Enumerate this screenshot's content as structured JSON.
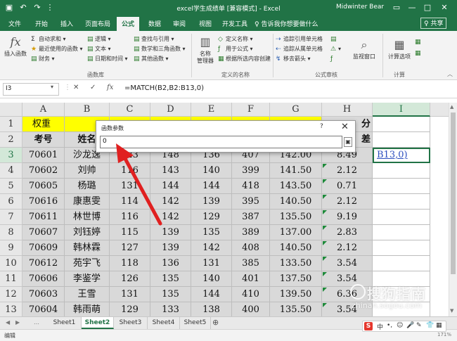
{
  "titlebar": {
    "title": "excel学生成绩单 [兼容模式] - Excel",
    "user": "Midwinter Bear",
    "icons": [
      "save-icon",
      "undo-icon",
      "redo-icon",
      "customize-icon"
    ]
  },
  "tabs": {
    "items": [
      "文件",
      "开始",
      "插入",
      "页面布局",
      "公式",
      "数据",
      "审阅",
      "视图",
      "开发工具"
    ],
    "active": "公式",
    "tell_me": "♀ 告诉我你想要做什么",
    "share": "♀ 共享"
  },
  "ribbon": {
    "insert_function": "插入函数",
    "autosum": "自动求和",
    "recent": "最近使用的函数",
    "financial": "财务",
    "logical": "逻辑",
    "text": "文本",
    "datetime": "日期和时间",
    "lookup": "查找与引用",
    "math": "数学和三角函数",
    "other": "其他函数",
    "group_library": "函数库",
    "name_manager": "名称\n管理器",
    "define_name": "定义名称",
    "use_in_formula": "用于公式",
    "create_from_sel": "根据所选内容创建",
    "group_names": "定义的名称",
    "trace_prec": "追踪引用单元格",
    "trace_dep": "追踪从属单元格",
    "remove_arrows": "移去箭头",
    "group_audit": "公式审核",
    "watch": "监视窗口",
    "calc_options": "计算选项",
    "group_calc": "计算"
  },
  "formula_bar": {
    "name_box": "I3",
    "formula": "=MATCH(B2,B2:B13,0)"
  },
  "grid": {
    "columns": [
      "A",
      "B",
      "C",
      "D",
      "E",
      "F",
      "G",
      "H",
      "I"
    ],
    "row_numbers": [
      "1",
      "2",
      "3",
      "4",
      "5",
      "6",
      "7",
      "8",
      "9",
      "10",
      "11",
      "12",
      "13"
    ],
    "row1": {
      "a": "权重",
      "h": "分"
    },
    "row2": {
      "a": "考号",
      "b": "姓名",
      "h": "差"
    },
    "rows": [
      {
        "a": "70601",
        "b": "沙龙逸",
        "c": "123",
        "d": "148",
        "e": "136",
        "f": "407",
        "g": "142.00",
        "h": "8.49"
      },
      {
        "a": "70602",
        "b": "刘帅",
        "c": "116",
        "d": "143",
        "e": "140",
        "f": "399",
        "g": "141.50",
        "h": "2.12"
      },
      {
        "a": "70605",
        "b": "杨璐",
        "c": "131",
        "d": "144",
        "e": "144",
        "f": "418",
        "g": "143.50",
        "h": "0.71"
      },
      {
        "a": "70616",
        "b": "康惠雯",
        "c": "114",
        "d": "142",
        "e": "139",
        "f": "395",
        "g": "140.50",
        "h": "2.12"
      },
      {
        "a": "70611",
        "b": "林世博",
        "c": "116",
        "d": "142",
        "e": "129",
        "f": "387",
        "g": "135.50",
        "h": "9.19"
      },
      {
        "a": "70607",
        "b": "刘钰婷",
        "c": "115",
        "d": "139",
        "e": "135",
        "f": "389",
        "g": "137.00",
        "h": "2.83"
      },
      {
        "a": "70609",
        "b": "韩林霖",
        "c": "127",
        "d": "139",
        "e": "142",
        "f": "408",
        "g": "140.50",
        "h": "2.12"
      },
      {
        "a": "70612",
        "b": "苑宇飞",
        "c": "118",
        "d": "136",
        "e": "131",
        "f": "385",
        "g": "133.50",
        "h": "3.54"
      },
      {
        "a": "70606",
        "b": "李鉴学",
        "c": "126",
        "d": "135",
        "e": "140",
        "f": "401",
        "g": "137.50",
        "h": "3.54"
      },
      {
        "a": "70603",
        "b": "王雪",
        "c": "131",
        "d": "135",
        "e": "144",
        "f": "410",
        "g": "139.50",
        "h": "6.36"
      },
      {
        "a": "70604",
        "b": "韩雨萌",
        "c": "129",
        "d": "133",
        "e": "138",
        "f": "400",
        "g": "135.50",
        "h": "3.54"
      }
    ],
    "i3": "B13,0)"
  },
  "dialog": {
    "title": "函数参数",
    "help": "?",
    "close": "✕",
    "input_value": "0"
  },
  "sheets": {
    "items": [
      "Sheet1",
      "Sheet2",
      "Sheet3",
      "Sheet4",
      "Sheet5"
    ],
    "active": "Sheet2"
  },
  "status": {
    "mode": "编辑",
    "zoom": "171%"
  },
  "ime": [
    "中",
    "•,",
    "☺",
    "🎤",
    "✎",
    "👕",
    "▦"
  ],
  "watermark": {
    "main": "搜狗指南",
    "sub": "zhinan.sogou.com"
  }
}
